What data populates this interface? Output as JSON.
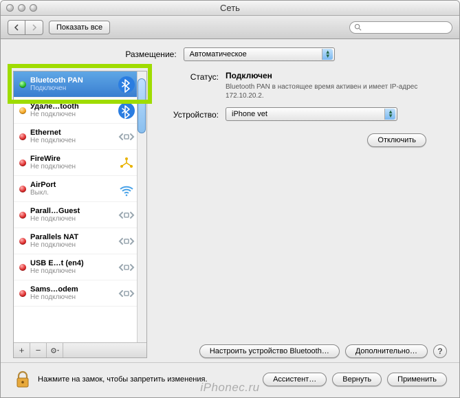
{
  "window": {
    "title": "Сеть"
  },
  "toolbar": {
    "show_all": "Показать все",
    "search_placeholder": ""
  },
  "location": {
    "label": "Размещение:",
    "value": "Автоматическое"
  },
  "sidebar": {
    "items": [
      {
        "name": "Bluetooth PAN",
        "sub": "Подключен",
        "status": "green",
        "icon": "bluetooth"
      },
      {
        "name": "Удале…tooth",
        "sub": "Не подключен",
        "status": "orange",
        "icon": "bluetooth"
      },
      {
        "name": "Ethernet",
        "sub": "Не подключен",
        "status": "red",
        "icon": "ethernet"
      },
      {
        "name": "FireWire",
        "sub": "Не подключен",
        "status": "red",
        "icon": "firewire"
      },
      {
        "name": "AirPort",
        "sub": "Выкл.",
        "status": "red",
        "icon": "wifi"
      },
      {
        "name": "Parall…Guest",
        "sub": "Не подключен",
        "status": "red",
        "icon": "ethernet"
      },
      {
        "name": "Parallels NAT",
        "sub": "Не подключен",
        "status": "red",
        "icon": "ethernet"
      },
      {
        "name": "USB E…t (en4)",
        "sub": "Не подключен",
        "status": "red",
        "icon": "ethernet"
      },
      {
        "name": "Sams…odem",
        "sub": "Не подключен",
        "status": "red",
        "icon": "ethernet"
      }
    ]
  },
  "detail": {
    "status_label": "Статус:",
    "status_value": "Подключен",
    "status_desc": "Bluetooth PAN в настоящее время активен и имеет IP-адрес 172.10.20.2.",
    "device_label": "Устройство:",
    "device_value": "iPhone vet",
    "disconnect": "Отключить",
    "configure_bt": "Настроить устройство Bluetooth…",
    "advanced": "Дополнительно…"
  },
  "footer": {
    "lock_text": "Нажмите на замок, чтобы запретить изменения.",
    "assistant": "Ассистент…",
    "revert": "Вернуть",
    "apply": "Применить"
  },
  "watermark": "iPhonec.ru"
}
